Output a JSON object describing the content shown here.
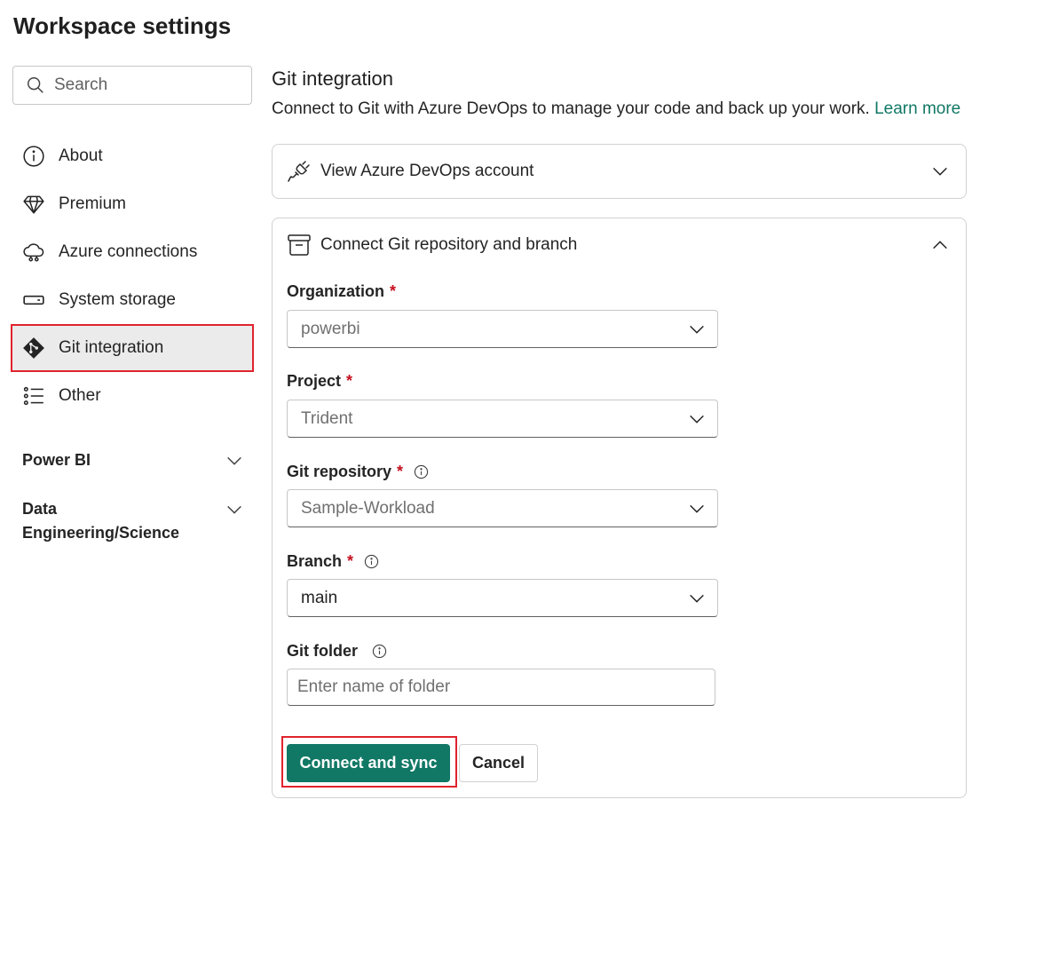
{
  "page": {
    "title": "Workspace settings"
  },
  "sidebar": {
    "search_placeholder": "Search",
    "items": [
      {
        "label": "About",
        "icon": "info-icon"
      },
      {
        "label": "Premium",
        "icon": "diamond-icon"
      },
      {
        "label": "Azure connections",
        "icon": "cloud-link-icon"
      },
      {
        "label": "System storage",
        "icon": "storage-icon"
      },
      {
        "label": "Git integration",
        "icon": "git-icon",
        "active": true
      },
      {
        "label": "Other",
        "icon": "list-icon"
      }
    ],
    "sections": [
      {
        "label": "Power BI",
        "expanded": false
      },
      {
        "label": "Data Engineering/Science",
        "expanded": false
      }
    ]
  },
  "main": {
    "title": "Git integration",
    "description": "Connect to Git with Azure DevOps to manage your code and back up your work.",
    "learn_more": "Learn more",
    "account_card": {
      "label": "View Azure DevOps account",
      "expanded": false
    },
    "repo_card": {
      "label": "Connect Git repository and branch",
      "expanded": true,
      "fields": {
        "organization": {
          "label": "Organization",
          "required": true,
          "value": "powerbi"
        },
        "project": {
          "label": "Project",
          "required": true,
          "value": "Trident"
        },
        "repository": {
          "label": "Git repository",
          "required": true,
          "value": "Sample-Workload"
        },
        "branch": {
          "label": "Branch",
          "required": true,
          "value": "main"
        },
        "folder": {
          "label": "Git folder",
          "required": false,
          "placeholder": "Enter name of folder"
        }
      },
      "connect_button": "Connect and sync",
      "cancel_button": "Cancel"
    }
  },
  "colors": {
    "accent": "#117865",
    "highlight": "#e0232e",
    "required": "#c50f1f"
  }
}
